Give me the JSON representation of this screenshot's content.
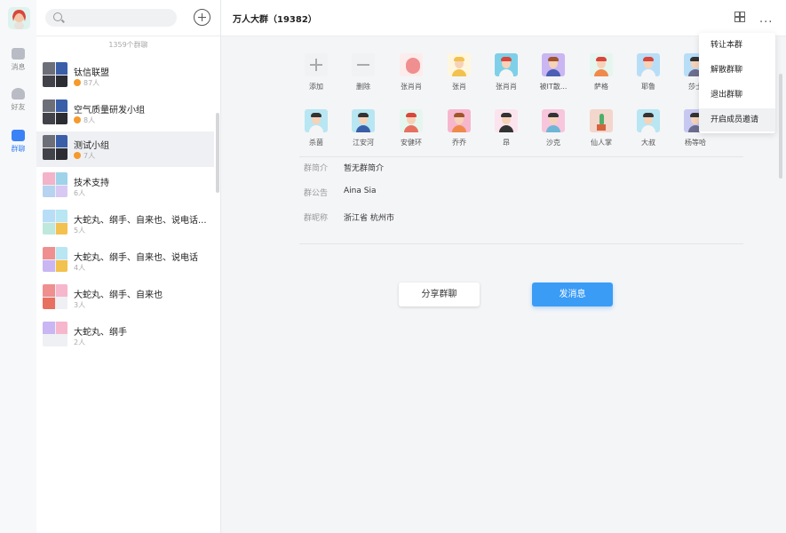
{
  "nav": {
    "items": [
      {
        "label": "消息"
      },
      {
        "label": "好友"
      },
      {
        "label": "群聊"
      }
    ]
  },
  "list": {
    "group_count": "1359个群聊",
    "groups": [
      {
        "name": "钛信联盟",
        "sub": "87人",
        "badge": true
      },
      {
        "name": "空气质量研发小组",
        "sub": "8人",
        "badge": true
      },
      {
        "name": "测试小组",
        "sub": "7人",
        "badge": true
      },
      {
        "name": "技术支持",
        "sub": "6人",
        "badge": false
      },
      {
        "name": "大蛇丸、纲手、自来也、说电话...",
        "sub": "5人",
        "badge": false
      },
      {
        "name": "大蛇丸、纲手、自来也、说电话",
        "sub": "4人",
        "badge": false
      },
      {
        "name": "大蛇丸、纲手、自来也",
        "sub": "3人",
        "badge": false
      },
      {
        "name": "大蛇丸、纲手",
        "sub": "2人",
        "badge": false
      }
    ]
  },
  "header": {
    "title": "万人大群（19382）",
    "more": "···"
  },
  "members": {
    "row1": [
      {
        "name": "添加",
        "kind": "add"
      },
      {
        "name": "删除",
        "kind": "remove"
      },
      {
        "name": "张肖肖",
        "color": "#ef8f8f"
      },
      {
        "name": "张肖",
        "color": "#f2c14e"
      },
      {
        "name": "张肖肖",
        "color": "#7ed0e8"
      },
      {
        "name": "被IT散...",
        "color": "#c9b6f2"
      },
      {
        "name": "萨格",
        "color": "#bfe8dc"
      },
      {
        "name": "耶鲁",
        "color": "#b8def7"
      },
      {
        "name": "莎士",
        "color": "#b8def7"
      }
    ],
    "row2": [
      {
        "name": "杀菌",
        "color": "#b8e6f2"
      },
      {
        "name": "江安河",
        "color": "#b8e6f2"
      },
      {
        "name": "安健环",
        "color": "#cfeee0"
      },
      {
        "name": "乔乔",
        "color": "#f6b7cd"
      },
      {
        "name": "昂",
        "color": "#f7c6dc"
      },
      {
        "name": "沙克",
        "color": "#f7c6dc"
      },
      {
        "name": "仙人掌",
        "color": "#f3d6cc"
      },
      {
        "name": "大叔",
        "color": "#b8e6f2"
      },
      {
        "name": "杨等哈",
        "color": "#c6c8f2"
      }
    ]
  },
  "info": {
    "intro_label": "群简介",
    "intro_value": "暂无群简介",
    "notice_label": "群公告",
    "notice_value": "Aina Sia",
    "nick_label": "群昵称",
    "nick_value": "浙江省 杭州市"
  },
  "actions": {
    "share": "分享群聊",
    "send": "发消息"
  },
  "menu": {
    "items": [
      "转让本群",
      "解散群聊",
      "退出群聊",
      "开启成员邀请"
    ]
  },
  "colors": {
    "accent": "#3b9cf6",
    "badge": "#f59a2b"
  }
}
